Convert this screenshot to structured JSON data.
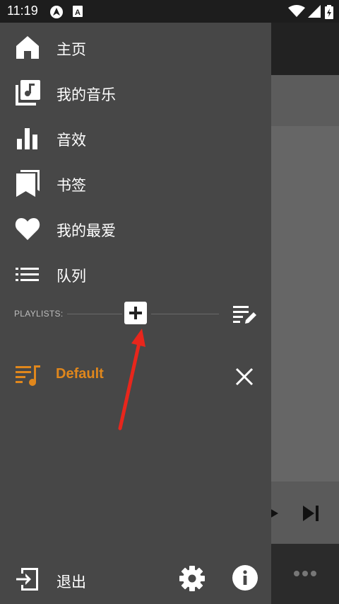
{
  "status_bar": {
    "time": "11:19",
    "left_icons": [
      "android-auto-icon",
      "a-badge-icon"
    ],
    "right_icons": [
      "wifi-icon",
      "signal-icon",
      "battery-icon"
    ]
  },
  "drawer": {
    "menu": [
      {
        "label": "主页",
        "icon": "home-icon"
      },
      {
        "label": "我的音乐",
        "icon": "music-library-icon"
      },
      {
        "label": "音效",
        "icon": "equalizer-icon"
      },
      {
        "label": "书签",
        "icon": "bookmark-icon"
      },
      {
        "label": "我的最爱",
        "icon": "heart-icon"
      },
      {
        "label": "队列",
        "icon": "queue-list-icon"
      }
    ],
    "playlists": {
      "header": "PLAYLISTS:",
      "items": [
        {
          "label": "Default",
          "icon": "playlist-icon"
        }
      ]
    },
    "footer": {
      "exit_label": "退出"
    }
  },
  "colors": {
    "drawer_bg": "#474747",
    "accent": "#e0871c",
    "annotation_arrow": "#e8261c"
  }
}
